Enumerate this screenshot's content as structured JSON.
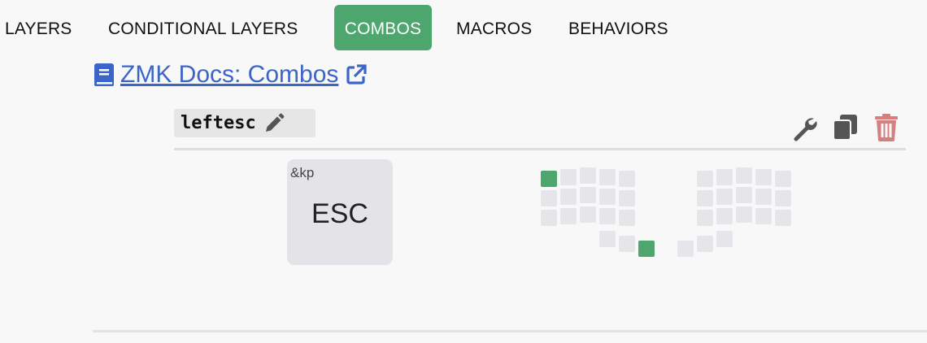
{
  "tabs": [
    {
      "label": "LAYERS",
      "active": false
    },
    {
      "label": "CONDITIONAL LAYERS",
      "active": false
    },
    {
      "label": "COMBOS",
      "active": true
    },
    {
      "label": "MACROS",
      "active": false
    },
    {
      "label": "BEHAVIORS",
      "active": false
    }
  ],
  "docs_link": {
    "text": "ZMK Docs: Combos",
    "icon_left": "book-icon",
    "icon_right": "external-link-icon"
  },
  "combo": {
    "name": "leftesc",
    "edit_icon": "pencil-icon",
    "actions": [
      "wrench-icon",
      "copy-icon",
      "trash-icon"
    ],
    "binding": {
      "behavior": "&kp",
      "param": "ESC"
    },
    "selected_positions": [
      "left top-left key",
      "left thumb outer key"
    ]
  },
  "colors": {
    "accent": "#4da66e",
    "link": "#3b65c9",
    "danger": "#d57f7f",
    "key": "#e6e6ea"
  }
}
